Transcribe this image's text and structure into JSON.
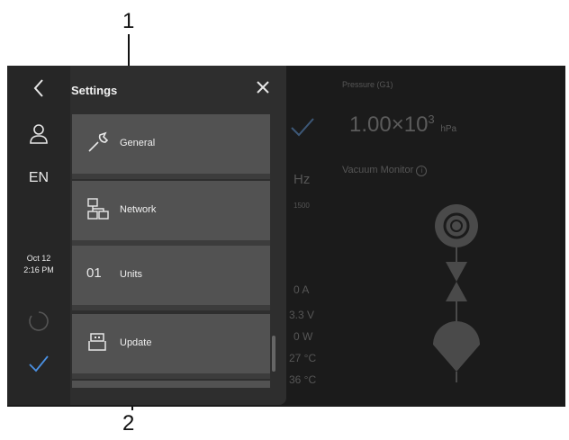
{
  "callouts": {
    "top": "1",
    "bottom": "2"
  },
  "panel": {
    "title": "Settings",
    "language": "EN",
    "date": "Oct 12",
    "time": "2:16 PM",
    "items": [
      {
        "label": "General",
        "icon": "wrench-icon"
      },
      {
        "label": "Network",
        "icon": "network-icon"
      },
      {
        "label": "Units",
        "icon": "units-icon",
        "icon_text": "01"
      },
      {
        "label": "Update",
        "icon": "usb-icon"
      }
    ]
  },
  "background": {
    "pressure_label": "Pressure (G1)",
    "pressure_mantissa": "1.00×10",
    "pressure_exponent": "3",
    "pressure_unit": "hPa",
    "frequency_unit": "Hz",
    "frequency_value": "1500",
    "vacuum_monitor_label": "Vacuum Monitor",
    "readings": [
      "0 A",
      "3.3 V",
      "0 W",
      "27 °C",
      "36 °C"
    ]
  },
  "colors": {
    "screen_bg": "#1b1b1b",
    "panel_bg": "#2e2e2e",
    "card_bg": "#525252",
    "accent": "#4a90e2"
  }
}
